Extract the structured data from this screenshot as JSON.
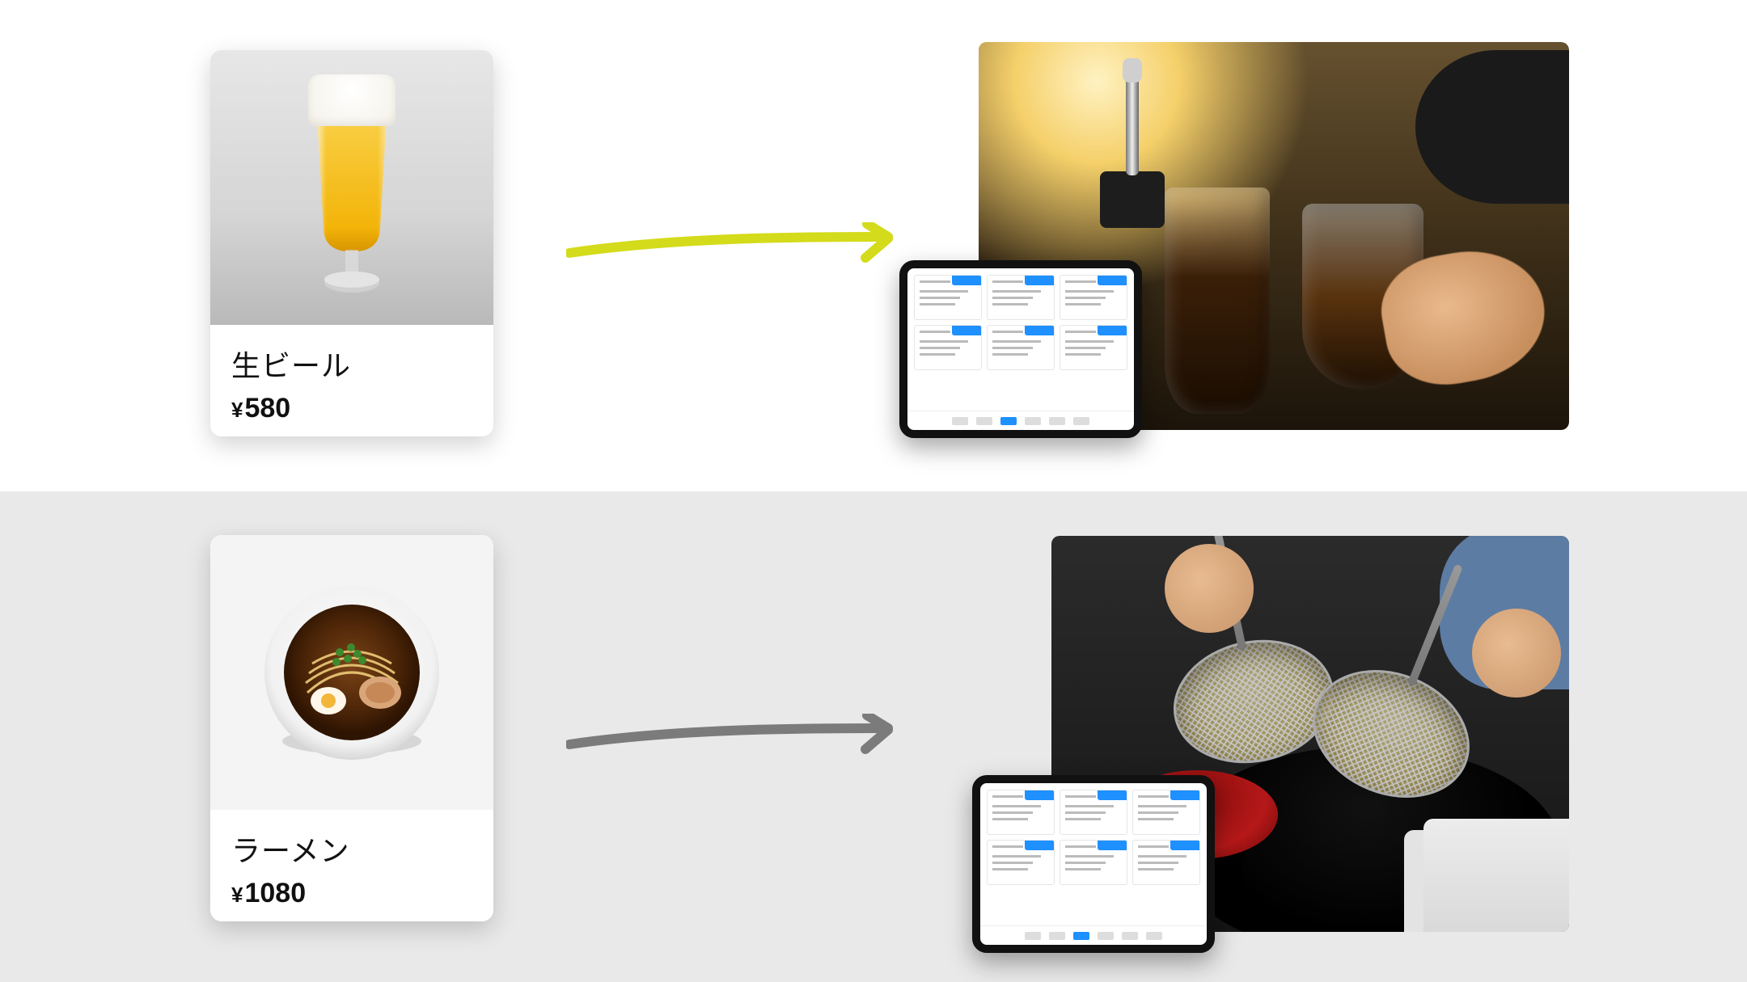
{
  "products": [
    {
      "name": "生ビール",
      "currency": "¥",
      "price": "580",
      "arrow_color": "#d4db1a"
    },
    {
      "name": "ラーメン",
      "currency": "¥",
      "price": "1080",
      "arrow_color": "#7b7b7b"
    }
  ],
  "icons": {
    "beer_glass": "beer-glass-icon",
    "ramen_bowl": "ramen-bowl-icon",
    "arrow": "arrow-right-icon",
    "tablet": "tablet-device-icon"
  }
}
